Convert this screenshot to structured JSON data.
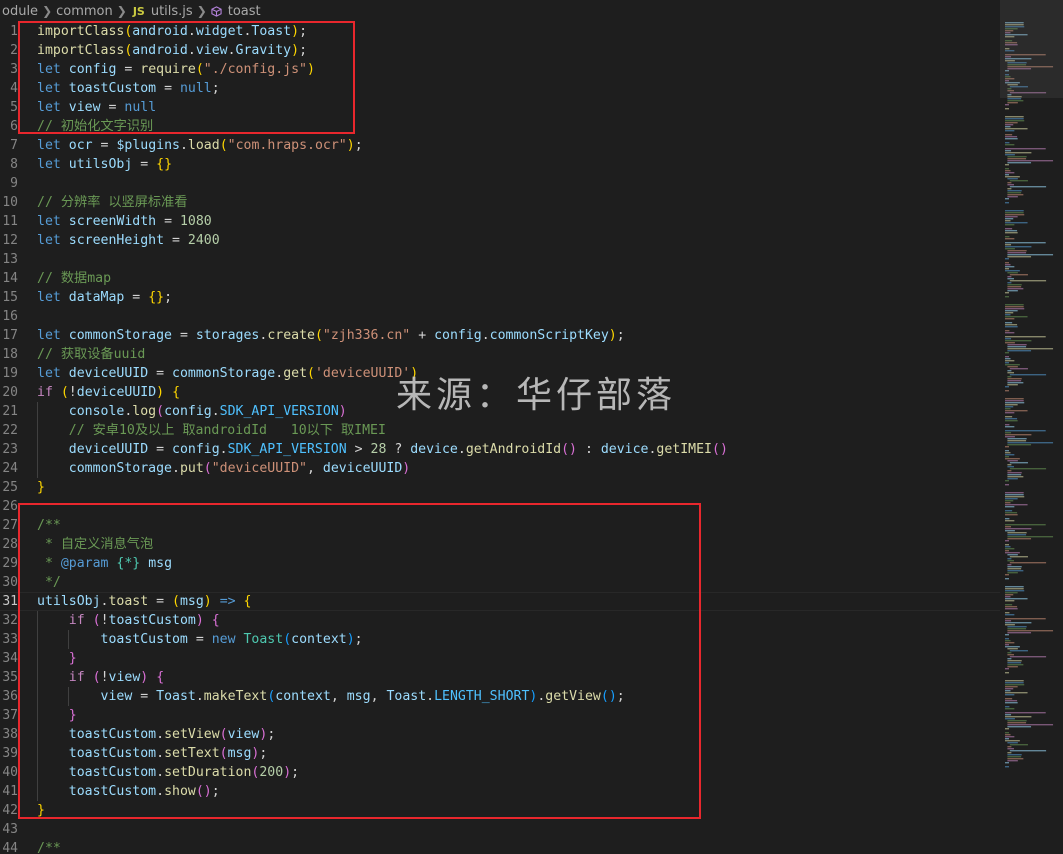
{
  "breadcrumb": {
    "items": [
      "odule",
      "common",
      "utils.js",
      "toast"
    ],
    "js_badge": "JS",
    "symbol_icon": "symbol-method-icon"
  },
  "watermark": "来源：华仔部落",
  "colors": {
    "background": "#1e1e1e",
    "annotation_box": "#e8272d",
    "keyword": "#569cd6",
    "control_keyword": "#c586c0",
    "function": "#dcdcaa",
    "variable": "#9cdcfe",
    "class": "#4ec9b0",
    "string": "#ce9178",
    "number": "#b5cea8",
    "comment": "#6a9955",
    "constant": "#4fc1ff"
  },
  "editor": {
    "active_line": 31,
    "lines": [
      {
        "n": "1",
        "t": [
          [
            "fn",
            "importClass"
          ],
          [
            "br1",
            "("
          ],
          [
            "var",
            "android"
          ],
          [
            "pun",
            "."
          ],
          [
            "var",
            "widget"
          ],
          [
            "pun",
            "."
          ],
          [
            "var",
            "Toast"
          ],
          [
            "br1",
            ")"
          ],
          [
            "pun",
            ";"
          ]
        ]
      },
      {
        "n": "2",
        "t": [
          [
            "fn",
            "importClass"
          ],
          [
            "br1",
            "("
          ],
          [
            "var",
            "android"
          ],
          [
            "pun",
            "."
          ],
          [
            "var",
            "view"
          ],
          [
            "pun",
            "."
          ],
          [
            "var",
            "Gravity"
          ],
          [
            "br1",
            ")"
          ],
          [
            "pun",
            ";"
          ]
        ]
      },
      {
        "n": "3",
        "t": [
          [
            "kw",
            "let"
          ],
          [
            "pun",
            " "
          ],
          [
            "var",
            "config"
          ],
          [
            "pun",
            " = "
          ],
          [
            "fn",
            "require"
          ],
          [
            "br1",
            "("
          ],
          [
            "str",
            "\"./config.js\""
          ],
          [
            "br1",
            ")"
          ]
        ]
      },
      {
        "n": "4",
        "t": [
          [
            "kw",
            "let"
          ],
          [
            "pun",
            " "
          ],
          [
            "var",
            "toastCustom"
          ],
          [
            "pun",
            " = "
          ],
          [
            "kw",
            "null"
          ],
          [
            "pun",
            ";"
          ]
        ]
      },
      {
        "n": "5",
        "t": [
          [
            "kw",
            "let"
          ],
          [
            "pun",
            " "
          ],
          [
            "var",
            "view"
          ],
          [
            "pun",
            " = "
          ],
          [
            "kw",
            "null"
          ]
        ]
      },
      {
        "n": "6",
        "t": [
          [
            "com",
            "// 初始化文字识别"
          ]
        ]
      },
      {
        "n": "7",
        "t": [
          [
            "kw",
            "let"
          ],
          [
            "pun",
            " "
          ],
          [
            "var",
            "ocr"
          ],
          [
            "pun",
            " = "
          ],
          [
            "var",
            "$plugins"
          ],
          [
            "pun",
            "."
          ],
          [
            "fn",
            "load"
          ],
          [
            "br1",
            "("
          ],
          [
            "str",
            "\"com.hraps.ocr\""
          ],
          [
            "br1",
            ")"
          ],
          [
            "pun",
            ";"
          ]
        ]
      },
      {
        "n": "8",
        "t": [
          [
            "kw",
            "let"
          ],
          [
            "pun",
            " "
          ],
          [
            "var",
            "utilsObj"
          ],
          [
            "pun",
            " = "
          ],
          [
            "br1",
            "{}"
          ]
        ]
      },
      {
        "n": "9",
        "t": []
      },
      {
        "n": "10",
        "t": [
          [
            "com",
            "// 分辨率 以竖屏标准看"
          ]
        ]
      },
      {
        "n": "11",
        "t": [
          [
            "kw",
            "let"
          ],
          [
            "pun",
            " "
          ],
          [
            "var",
            "screenWidth"
          ],
          [
            "pun",
            " = "
          ],
          [
            "num",
            "1080"
          ]
        ]
      },
      {
        "n": "12",
        "t": [
          [
            "kw",
            "let"
          ],
          [
            "pun",
            " "
          ],
          [
            "var",
            "screenHeight"
          ],
          [
            "pun",
            " = "
          ],
          [
            "num",
            "2400"
          ]
        ]
      },
      {
        "n": "13",
        "t": []
      },
      {
        "n": "14",
        "t": [
          [
            "com",
            "// 数据map"
          ]
        ]
      },
      {
        "n": "15",
        "t": [
          [
            "kw",
            "let"
          ],
          [
            "pun",
            " "
          ],
          [
            "var",
            "dataMap"
          ],
          [
            "pun",
            " = "
          ],
          [
            "br1",
            "{}"
          ],
          [
            "pun",
            ";"
          ]
        ]
      },
      {
        "n": "16",
        "t": []
      },
      {
        "n": "17",
        "t": [
          [
            "kw",
            "let"
          ],
          [
            "pun",
            " "
          ],
          [
            "var",
            "commonStorage"
          ],
          [
            "pun",
            " = "
          ],
          [
            "var",
            "storages"
          ],
          [
            "pun",
            "."
          ],
          [
            "fn",
            "create"
          ],
          [
            "br1",
            "("
          ],
          [
            "str",
            "\"zjh336.cn\""
          ],
          [
            "pun",
            " + "
          ],
          [
            "var",
            "config"
          ],
          [
            "pun",
            "."
          ],
          [
            "var",
            "commonScriptKey"
          ],
          [
            "br1",
            ")"
          ],
          [
            "pun",
            ";"
          ]
        ]
      },
      {
        "n": "18",
        "t": [
          [
            "com",
            "// 获取设备uuid"
          ]
        ]
      },
      {
        "n": "19",
        "t": [
          [
            "kw",
            "let"
          ],
          [
            "pun",
            " "
          ],
          [
            "var",
            "deviceUUID"
          ],
          [
            "pun",
            " = "
          ],
          [
            "var",
            "commonStorage"
          ],
          [
            "pun",
            "."
          ],
          [
            "fn",
            "get"
          ],
          [
            "br1",
            "("
          ],
          [
            "str",
            "'deviceUUID'"
          ],
          [
            "br1",
            ")"
          ]
        ]
      },
      {
        "n": "20",
        "t": [
          [
            "kw2",
            "if"
          ],
          [
            "pun",
            " "
          ],
          [
            "br1",
            "("
          ],
          [
            "pun",
            "!"
          ],
          [
            "var",
            "deviceUUID"
          ],
          [
            "br1",
            ")"
          ],
          [
            "pun",
            " "
          ],
          [
            "br1",
            "{"
          ]
        ]
      },
      {
        "n": "21",
        "t": [
          [
            "pun",
            "    "
          ],
          [
            "var",
            "console"
          ],
          [
            "pun",
            "."
          ],
          [
            "fn",
            "log"
          ],
          [
            "br2",
            "("
          ],
          [
            "var",
            "config"
          ],
          [
            "pun",
            "."
          ],
          [
            "cst",
            "SDK_API_VERSION"
          ],
          [
            "br2",
            ")"
          ]
        ]
      },
      {
        "n": "22",
        "t": [
          [
            "pun",
            "    "
          ],
          [
            "com",
            "// 安卓10及以上 取androidId   10以下 取IMEI"
          ]
        ]
      },
      {
        "n": "23",
        "t": [
          [
            "pun",
            "    "
          ],
          [
            "var",
            "deviceUUID"
          ],
          [
            "pun",
            " = "
          ],
          [
            "var",
            "config"
          ],
          [
            "pun",
            "."
          ],
          [
            "cst",
            "SDK_API_VERSION"
          ],
          [
            "pun",
            " > "
          ],
          [
            "num",
            "28"
          ],
          [
            "pun",
            " ? "
          ],
          [
            "var",
            "device"
          ],
          [
            "pun",
            "."
          ],
          [
            "fn",
            "getAndroidId"
          ],
          [
            "br2",
            "()"
          ],
          [
            "pun",
            " : "
          ],
          [
            "var",
            "device"
          ],
          [
            "pun",
            "."
          ],
          [
            "fn",
            "getIMEI"
          ],
          [
            "br2",
            "()"
          ]
        ]
      },
      {
        "n": "24",
        "t": [
          [
            "pun",
            "    "
          ],
          [
            "var",
            "commonStorage"
          ],
          [
            "pun",
            "."
          ],
          [
            "fn",
            "put"
          ],
          [
            "br2",
            "("
          ],
          [
            "str",
            "\"deviceUUID\""
          ],
          [
            "pun",
            ", "
          ],
          [
            "var",
            "deviceUUID"
          ],
          [
            "br2",
            ")"
          ]
        ]
      },
      {
        "n": "25",
        "t": [
          [
            "br1",
            "}"
          ]
        ]
      },
      {
        "n": "26",
        "t": []
      },
      {
        "n": "27",
        "t": [
          [
            "com",
            "/**"
          ]
        ]
      },
      {
        "n": "28",
        "t": [
          [
            "com",
            " * 自定义消息气泡"
          ]
        ]
      },
      {
        "n": "29",
        "t": [
          [
            "com",
            " * "
          ],
          [
            "tag",
            "@param"
          ],
          [
            "com",
            " "
          ],
          [
            "cls",
            "{*}"
          ],
          [
            "com",
            " "
          ],
          [
            "var",
            "msg"
          ]
        ]
      },
      {
        "n": "30",
        "t": [
          [
            "com",
            " */"
          ]
        ]
      },
      {
        "n": "31",
        "t": [
          [
            "var",
            "utilsObj"
          ],
          [
            "pun",
            "."
          ],
          [
            "fn",
            "toast"
          ],
          [
            "pun",
            " = "
          ],
          [
            "br1",
            "("
          ],
          [
            "var",
            "msg"
          ],
          [
            "br1",
            ")"
          ],
          [
            "pun",
            " "
          ],
          [
            "kw",
            "=>"
          ],
          [
            "pun",
            " "
          ],
          [
            "br1",
            "{"
          ]
        ]
      },
      {
        "n": "32",
        "t": [
          [
            "pun",
            "    "
          ],
          [
            "kw2",
            "if"
          ],
          [
            "pun",
            " "
          ],
          [
            "br2",
            "("
          ],
          [
            "pun",
            "!"
          ],
          [
            "var",
            "toastCustom"
          ],
          [
            "br2",
            ")"
          ],
          [
            "pun",
            " "
          ],
          [
            "br2",
            "{"
          ]
        ]
      },
      {
        "n": "33",
        "t": [
          [
            "pun",
            "        "
          ],
          [
            "var",
            "toastCustom"
          ],
          [
            "pun",
            " = "
          ],
          [
            "kw",
            "new"
          ],
          [
            "pun",
            " "
          ],
          [
            "cls",
            "Toast"
          ],
          [
            "br3",
            "("
          ],
          [
            "var",
            "context"
          ],
          [
            "br3",
            ")"
          ],
          [
            "pun",
            ";"
          ]
        ]
      },
      {
        "n": "34",
        "t": [
          [
            "pun",
            "    "
          ],
          [
            "br2",
            "}"
          ]
        ]
      },
      {
        "n": "35",
        "t": [
          [
            "pun",
            "    "
          ],
          [
            "kw2",
            "if"
          ],
          [
            "pun",
            " "
          ],
          [
            "br2",
            "("
          ],
          [
            "pun",
            "!"
          ],
          [
            "var",
            "view"
          ],
          [
            "br2",
            ")"
          ],
          [
            "pun",
            " "
          ],
          [
            "br2",
            "{"
          ]
        ]
      },
      {
        "n": "36",
        "t": [
          [
            "pun",
            "        "
          ],
          [
            "var",
            "view"
          ],
          [
            "pun",
            " = "
          ],
          [
            "var",
            "Toast"
          ],
          [
            "pun",
            "."
          ],
          [
            "fn",
            "makeText"
          ],
          [
            "br3",
            "("
          ],
          [
            "var",
            "context"
          ],
          [
            "pun",
            ", "
          ],
          [
            "var",
            "msg"
          ],
          [
            "pun",
            ", "
          ],
          [
            "var",
            "Toast"
          ],
          [
            "pun",
            "."
          ],
          [
            "cst",
            "LENGTH_SHORT"
          ],
          [
            "br3",
            ")"
          ],
          [
            "pun",
            "."
          ],
          [
            "fn",
            "getView"
          ],
          [
            "br3",
            "()"
          ],
          [
            "pun",
            ";"
          ]
        ]
      },
      {
        "n": "37",
        "t": [
          [
            "pun",
            "    "
          ],
          [
            "br2",
            "}"
          ]
        ]
      },
      {
        "n": "38",
        "t": [
          [
            "pun",
            "    "
          ],
          [
            "var",
            "toastCustom"
          ],
          [
            "pun",
            "."
          ],
          [
            "fn",
            "setView"
          ],
          [
            "br2",
            "("
          ],
          [
            "var",
            "view"
          ],
          [
            "br2",
            ")"
          ],
          [
            "pun",
            ";"
          ]
        ]
      },
      {
        "n": "39",
        "t": [
          [
            "pun",
            "    "
          ],
          [
            "var",
            "toastCustom"
          ],
          [
            "pun",
            "."
          ],
          [
            "fn",
            "setText"
          ],
          [
            "br2",
            "("
          ],
          [
            "var",
            "msg"
          ],
          [
            "br2",
            ")"
          ],
          [
            "pun",
            ";"
          ]
        ]
      },
      {
        "n": "40",
        "t": [
          [
            "pun",
            "    "
          ],
          [
            "var",
            "toastCustom"
          ],
          [
            "pun",
            "."
          ],
          [
            "fn",
            "setDuration"
          ],
          [
            "br2",
            "("
          ],
          [
            "num",
            "200"
          ],
          [
            "br2",
            ")"
          ],
          [
            "pun",
            ";"
          ]
        ]
      },
      {
        "n": "41",
        "t": [
          [
            "pun",
            "    "
          ],
          [
            "var",
            "toastCustom"
          ],
          [
            "pun",
            "."
          ],
          [
            "fn",
            "show"
          ],
          [
            "br2",
            "()"
          ],
          [
            "pun",
            ";"
          ]
        ]
      },
      {
        "n": "42",
        "t": [
          [
            "br1",
            "}"
          ]
        ]
      },
      {
        "n": "43",
        "t": []
      },
      {
        "n": "44",
        "t": [
          [
            "com",
            "/**"
          ]
        ]
      }
    ]
  }
}
